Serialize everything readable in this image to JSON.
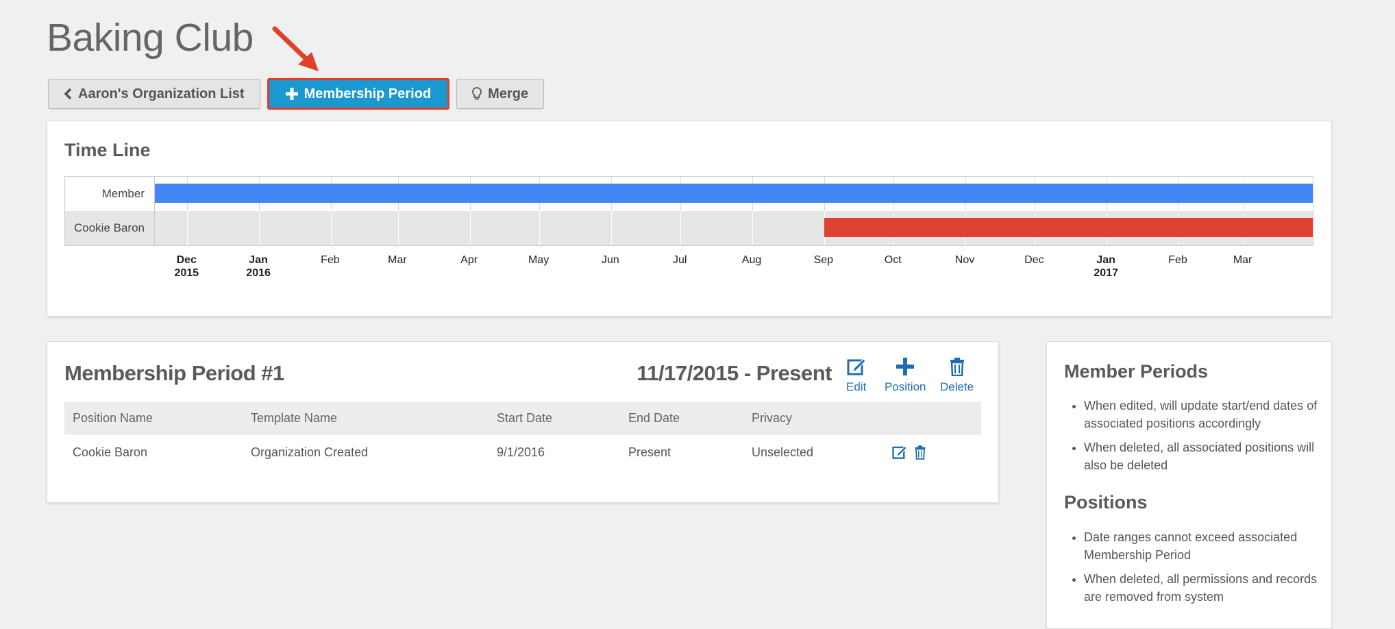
{
  "page": {
    "title": "Baking Club"
  },
  "toolbar": {
    "back_label": "Aaron's Organization List",
    "add_period_label": "Membership Period",
    "merge_label": "Merge"
  },
  "colors": {
    "primary_button": "#1b98cf",
    "highlight_border": "#e23d28",
    "member_bar": "#4285f4",
    "position_bar": "#de4032",
    "link": "#1f6cb5"
  },
  "timeline": {
    "heading": "Time Line",
    "rows": [
      {
        "label": "Member",
        "start": "2015-11-17",
        "end": "2017-03-31",
        "color": "#4285f4"
      },
      {
        "label": "Cookie Baron",
        "start": "2016-09-01",
        "end": "2017-03-31",
        "color": "#de4032"
      }
    ],
    "domain": [
      "2015-11-17",
      "2017-03-31"
    ],
    "months": [
      {
        "date": "2015-12-01",
        "label": "Dec",
        "year": "2015"
      },
      {
        "date": "2016-01-01",
        "label": "Jan",
        "year": "2016"
      },
      {
        "date": "2016-02-01",
        "label": "Feb"
      },
      {
        "date": "2016-03-01",
        "label": "Mar"
      },
      {
        "date": "2016-04-01",
        "label": "Apr"
      },
      {
        "date": "2016-05-01",
        "label": "May"
      },
      {
        "date": "2016-06-01",
        "label": "Jun"
      },
      {
        "date": "2016-07-01",
        "label": "Jul"
      },
      {
        "date": "2016-08-01",
        "label": "Aug"
      },
      {
        "date": "2016-09-01",
        "label": "Sep"
      },
      {
        "date": "2016-10-01",
        "label": "Oct"
      },
      {
        "date": "2016-11-01",
        "label": "Nov"
      },
      {
        "date": "2016-12-01",
        "label": "Dec"
      },
      {
        "date": "2017-01-01",
        "label": "Jan",
        "year": "2017"
      },
      {
        "date": "2017-02-01",
        "label": "Feb"
      },
      {
        "date": "2017-03-01",
        "label": "Mar"
      }
    ]
  },
  "period": {
    "heading": "Membership Period #1",
    "range": "11/17/2015 - Present",
    "actions": {
      "edit": "Edit",
      "position": "Position",
      "delete": "Delete"
    },
    "columns": [
      "Position Name",
      "Template Name",
      "Start Date",
      "End Date",
      "Privacy"
    ],
    "rows": [
      {
        "position": "Cookie Baron",
        "template": "Organization Created",
        "start": "9/1/2016",
        "end": "Present",
        "privacy": "Unselected"
      }
    ]
  },
  "help": {
    "member_heading": "Member Periods",
    "member_items": [
      "When edited, will update start/end dates of associated positions accordingly",
      "When deleted, all associated positions will also be deleted"
    ],
    "positions_heading": "Positions",
    "positions_items": [
      "Date ranges cannot exceed associated Membership Period",
      "When deleted, all permissions and records are removed from system"
    ]
  }
}
